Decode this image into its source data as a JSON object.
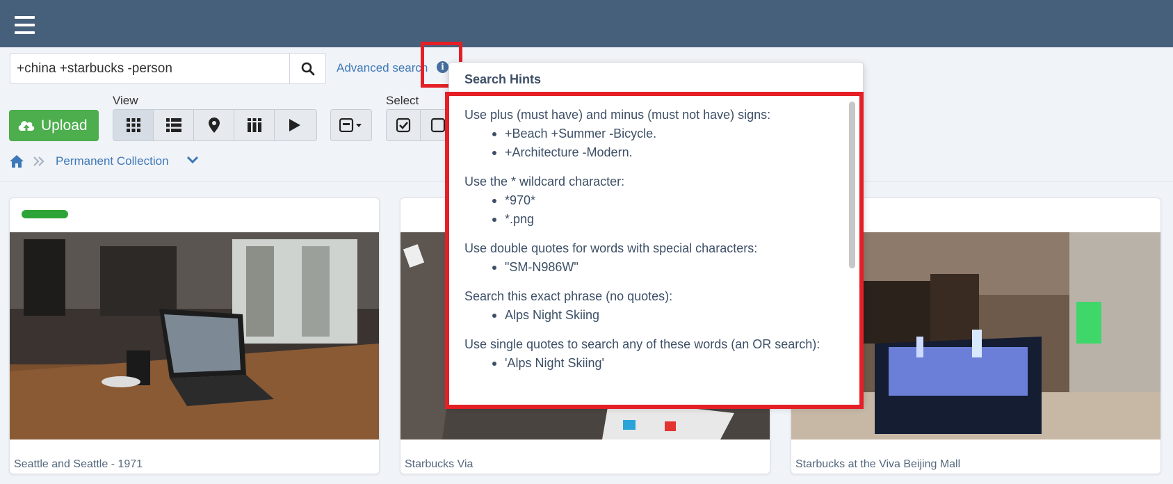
{
  "search": {
    "query": "+china +starbucks -person",
    "advanced_label": "Advanced search"
  },
  "toolbar": {
    "view_label": "View",
    "select_label": "Select",
    "upload_label": "Upload"
  },
  "breadcrumb": {
    "current": "Permanent Collection"
  },
  "hints": {
    "title": "Search Hints",
    "groups": [
      {
        "heading": "Use plus (must have) and minus (must not have) signs:",
        "items": [
          "+Beach +Summer -Bicycle.",
          "+Architecture -Modern."
        ]
      },
      {
        "heading": "Use the * wildcard character:",
        "items": [
          "*970*",
          "*.png"
        ]
      },
      {
        "heading": "Use double quotes for words with special characters:",
        "items": [
          "\"SM-N986W\""
        ]
      },
      {
        "heading": "Search this exact phrase (no quotes):",
        "items": [
          "Alps Night Skiing"
        ]
      },
      {
        "heading": "Use single quotes to search any of these words (an OR search):",
        "items": [
          "'Alps Night Skiing'"
        ]
      }
    ]
  },
  "cards": [
    {
      "caption": "Seattle and Seattle - 1971"
    },
    {
      "caption": "Starbucks Via"
    },
    {
      "caption": "Starbucks at the Viva Beijing Mall"
    }
  ],
  "colors": {
    "header": "#465f7b",
    "upload": "#4cae4c",
    "link": "#3e78b8",
    "highlight": "#e41f25",
    "tag": "#2ea337"
  }
}
